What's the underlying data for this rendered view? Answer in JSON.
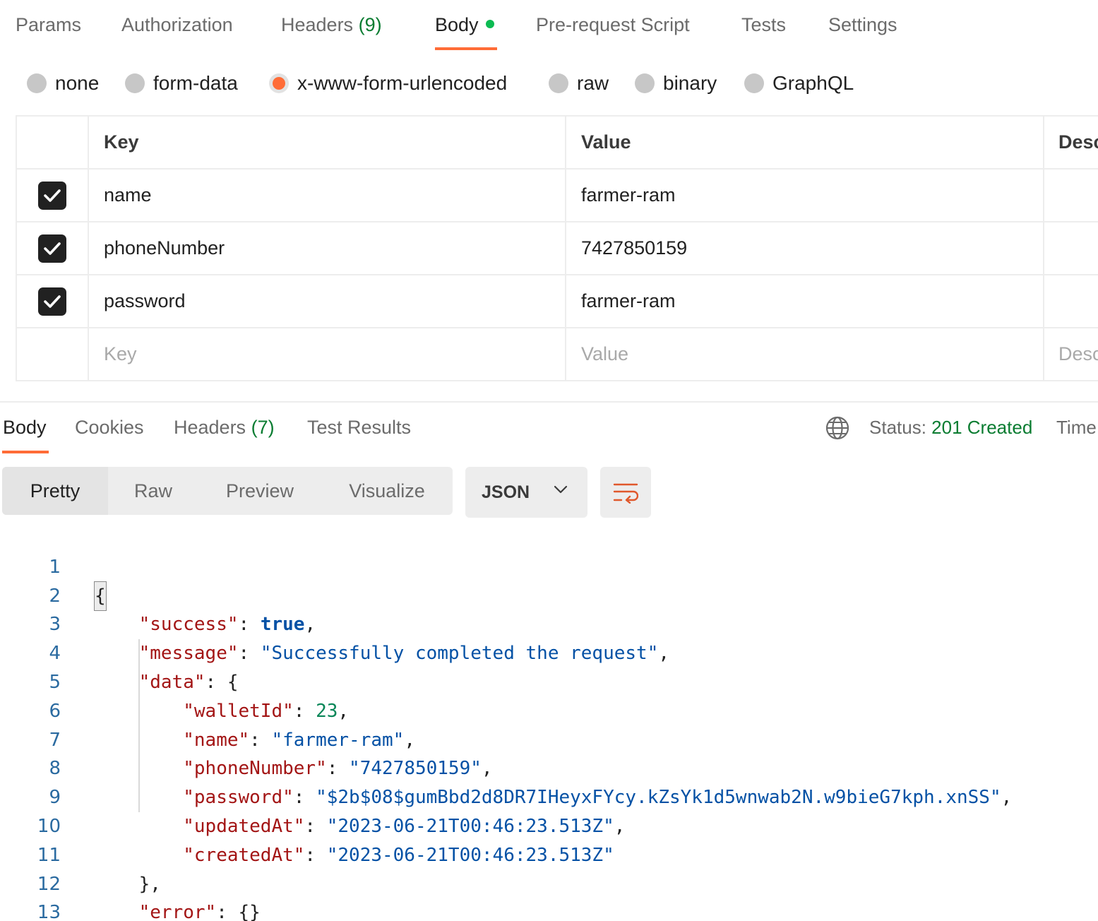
{
  "request_tabs": {
    "params": "Params",
    "authorization": "Authorization",
    "headers_label": "Headers",
    "headers_count": "(9)",
    "body": "Body",
    "pre_request_script": "Pre-request Script",
    "tests": "Tests",
    "settings": "Settings"
  },
  "body_types": {
    "none": "none",
    "form_data": "form-data",
    "urlencoded": "x-www-form-urlencoded",
    "raw": "raw",
    "binary": "binary",
    "graphql": "GraphQL",
    "selected": "x-www-form-urlencoded"
  },
  "kv_table": {
    "headers": {
      "key": "Key",
      "value": "Value",
      "description": "Desc"
    },
    "rows": [
      {
        "checked": true,
        "key": "name",
        "value": "farmer-ram"
      },
      {
        "checked": true,
        "key": "phoneNumber",
        "value": "7427850159"
      },
      {
        "checked": true,
        "key": "password",
        "value": "farmer-ram"
      }
    ],
    "placeholders": {
      "key": "Key",
      "value": "Value",
      "description": "Desc"
    }
  },
  "response": {
    "tabs": {
      "body": "Body",
      "cookies": "Cookies",
      "headers_label": "Headers",
      "headers_count": "(7)",
      "test_results": "Test Results"
    },
    "status_label": "Status:",
    "status_value": "201 Created",
    "time_label": "Time",
    "view_modes": {
      "pretty": "Pretty",
      "raw": "Raw",
      "preview": "Preview",
      "visualize": "Visualize"
    },
    "format": "JSON",
    "line_numbers": [
      "1",
      "2",
      "3",
      "4",
      "5",
      "6",
      "7",
      "8",
      "9",
      "10",
      "11",
      "12",
      "13"
    ],
    "json": {
      "success_key": "\"success\"",
      "success_val": "true",
      "message_key": "\"message\"",
      "message_val": "\"Successfully completed the request\"",
      "data_key": "\"data\"",
      "walletId_key": "\"walletId\"",
      "walletId_val": "23",
      "name_key": "\"name\"",
      "name_val": "\"farmer-ram\"",
      "phoneNumber_key": "\"phoneNumber\"",
      "phoneNumber_val": "\"7427850159\"",
      "password_key": "\"password\"",
      "password_val": "\"$2b$08$gumBbd2d8DR7IHeyxFYcy.kZsYk1d5wnwab2N.w9bieG7kph.xnSS\"",
      "updatedAt_key": "\"updatedAt\"",
      "updatedAt_val": "\"2023-06-21T00:46:23.513Z\"",
      "createdAt_key": "\"createdAt\"",
      "createdAt_val": "\"2023-06-21T00:46:23.513Z\"",
      "error_key": "\"error\"",
      "error_val": "{}"
    }
  },
  "colors": {
    "accent": "#ff6c37",
    "success_green": "#0a7c31",
    "json_key": "#a31515",
    "json_string": "#0451a5",
    "json_number": "#098658"
  }
}
